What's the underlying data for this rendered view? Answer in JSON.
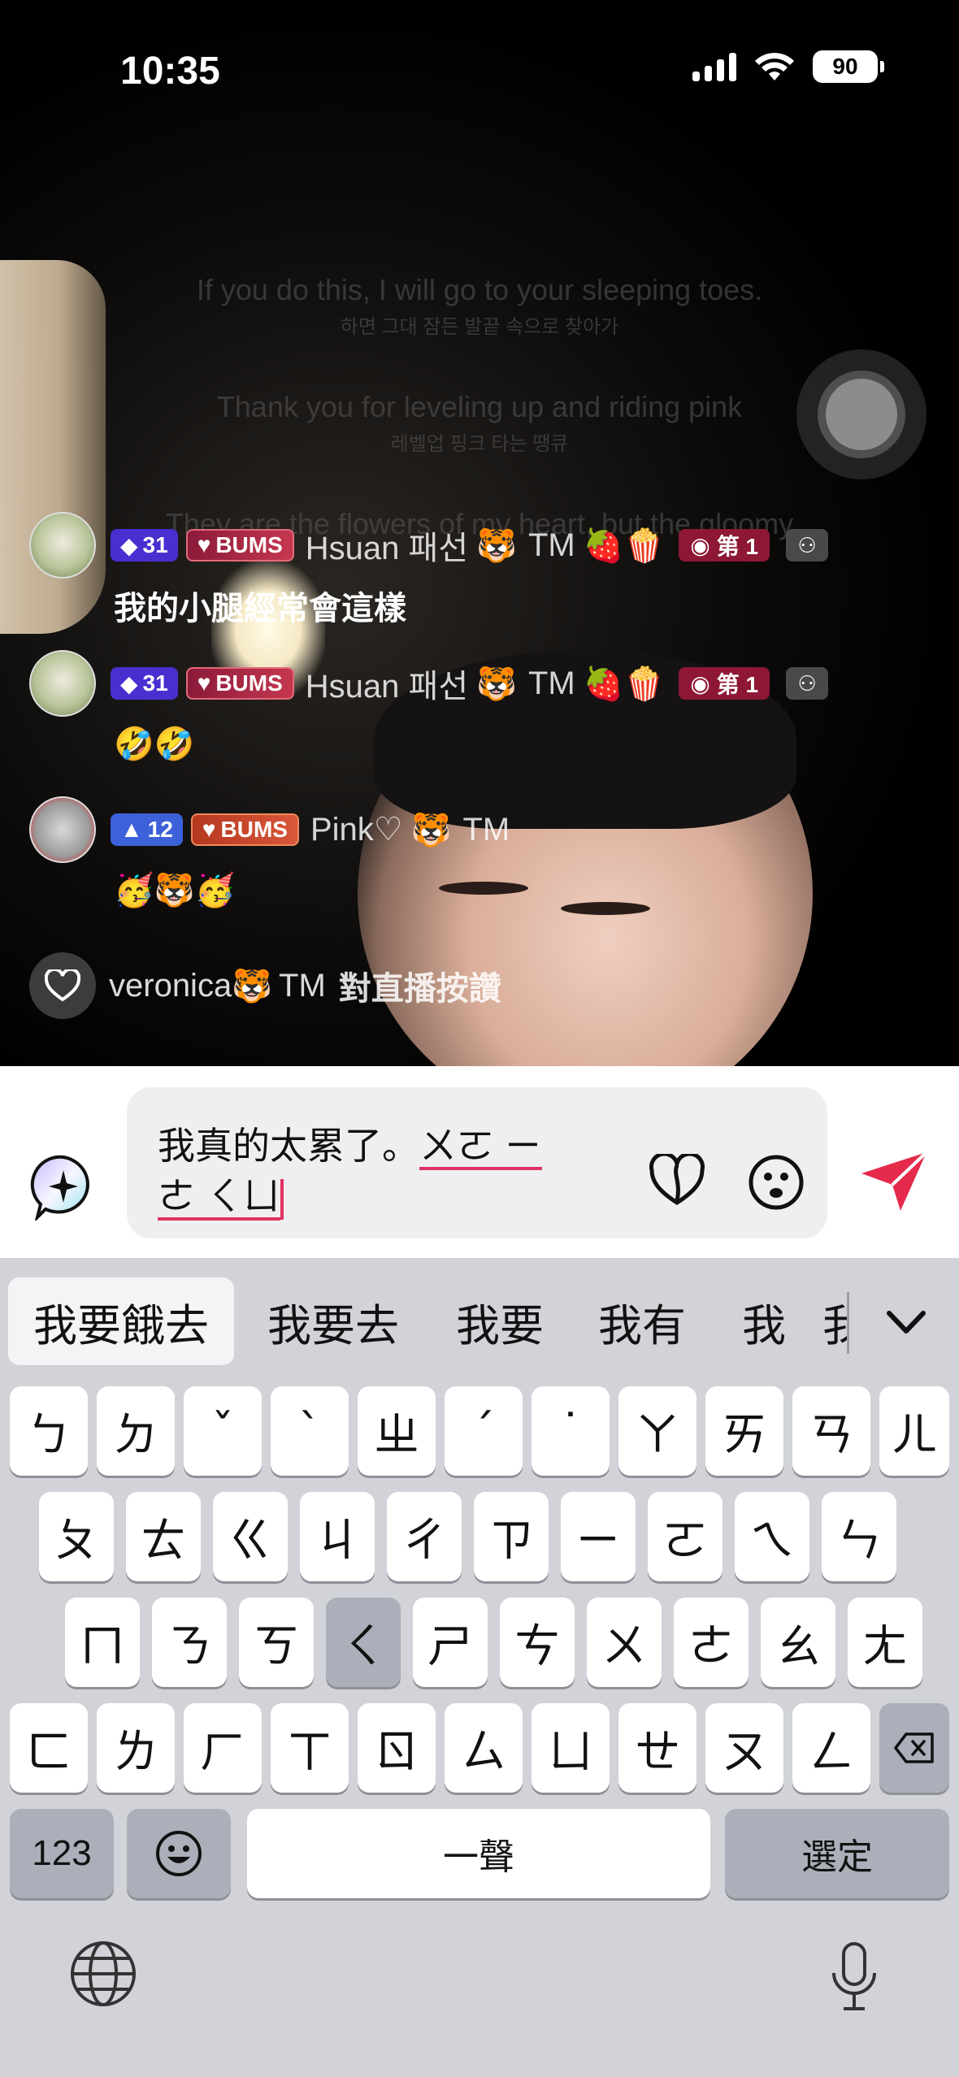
{
  "status_bar": {
    "time": "10:35",
    "battery": "90"
  },
  "lyrics": [
    {
      "en": "If you do this, I will go to your sleeping toes.",
      "ko": "하면 그대 잠든 발끝 속으로 찾아가"
    },
    {
      "en": "Thank you for leveling up and riding pink",
      "ko": "레벨업 핑크 타는 땡큐"
    },
    {
      "en": "They are the flowers of my heart, but the gloomy",
      "ko": ""
    }
  ],
  "chat": [
    {
      "level": "31",
      "club": "BUMS",
      "username": "Hsuan 패선",
      "tags": "TM",
      "emojis": "🐯",
      "extras": "🍓🍿",
      "rank": "第 1",
      "message": "我的小腿經常會這樣"
    },
    {
      "level": "31",
      "club": "BUMS",
      "username": "Hsuan 패선",
      "tags": "TM",
      "emojis": "🐯",
      "extras": "🍓🍿",
      "rank": "第 1",
      "message": "🤣🤣"
    },
    {
      "level": "12",
      "club": "BUMS",
      "username": "Pink♡",
      "tags": "TM",
      "emojis": "🐯",
      "message": "🥳🐯🥳"
    }
  ],
  "like_event": {
    "username": "veronica",
    "emoji": "🐯",
    "tags": "TM",
    "text": "對直播按讚"
  },
  "composer": {
    "line1_committed": "我真的太累了。",
    "line1_composing": "ㄨㄛ ㄧ",
    "line2_composing": "ㄜ ㄑㄩ"
  },
  "candidates": [
    "我要餓去",
    "我要去",
    "我要",
    "我有",
    "我",
    "我"
  ],
  "keyboard": {
    "row1": [
      "ㄅ",
      "ㄉ",
      "ˇ",
      "ˋ",
      "ㄓ",
      "ˊ",
      "˙",
      "ㄚ",
      "ㄞ",
      "ㄢ",
      "ㄦ"
    ],
    "row2": [
      "ㄆ",
      "ㄊ",
      "ㄍ",
      "ㄐ",
      "ㄔ",
      "ㄗ",
      "ㄧ",
      "ㄛ",
      "ㄟ",
      "ㄣ"
    ],
    "row3": [
      "ㄇ",
      "ㄋ",
      "ㄎ",
      "ㄑ",
      "ㄕ",
      "ㄘ",
      "ㄨ",
      "ㄜ",
      "ㄠ",
      "ㄤ"
    ],
    "row4": [
      "ㄈ",
      "ㄌ",
      "ㄏ",
      "ㄒ",
      "ㄖ",
      "ㄙ",
      "ㄩ",
      "ㄝ",
      "ㄡ",
      "ㄥ"
    ],
    "numbers_label": "123",
    "space_label": "一聲",
    "confirm_label": "選定"
  },
  "colors": {
    "accent": "#e03262",
    "send": "#e52a4c",
    "keyboard_bg": "#d1d3d9"
  }
}
